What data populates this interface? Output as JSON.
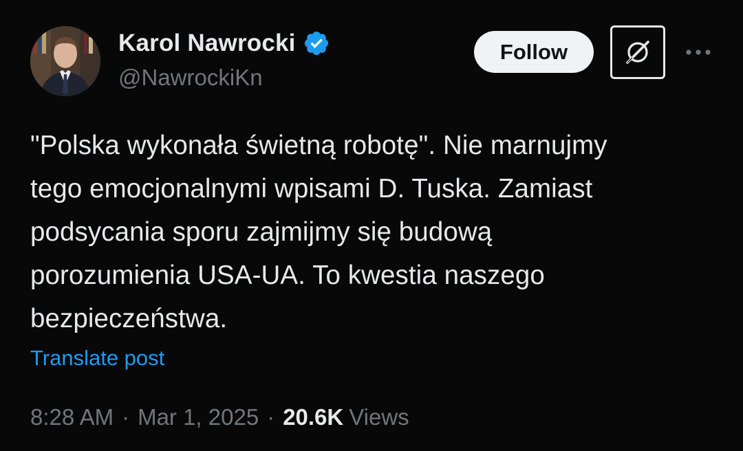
{
  "author": {
    "display_name": "Karol Nawrocki",
    "handle": "@NawrockiKn",
    "verified": true,
    "verified_color": "#1d9bf0"
  },
  "actions": {
    "follow_label": "Follow",
    "grok_icon": "grok-icon",
    "more_icon": "more-horizontal-icon"
  },
  "post": {
    "text": "\"Polska wykonała świetną robotę\". Nie marnujmy\ntego emocjonalnymi wpisami D. Tuska. Zamiast\npodsycania sporu zajmijmy się budową\nporozumienia USA-UA. To kwestia naszego\nbezpieczeństwa.",
    "translate_label": "Translate post"
  },
  "meta": {
    "time": "8:28 AM",
    "separator": "·",
    "date": "Mar 1, 2025",
    "views_count": "20.6K",
    "views_label": "Views"
  },
  "colors": {
    "background": "#080808",
    "text_primary": "#e7e9ea",
    "text_secondary": "#71767b",
    "link": "#1d9bf0",
    "follow_bg": "#eff3f4"
  }
}
